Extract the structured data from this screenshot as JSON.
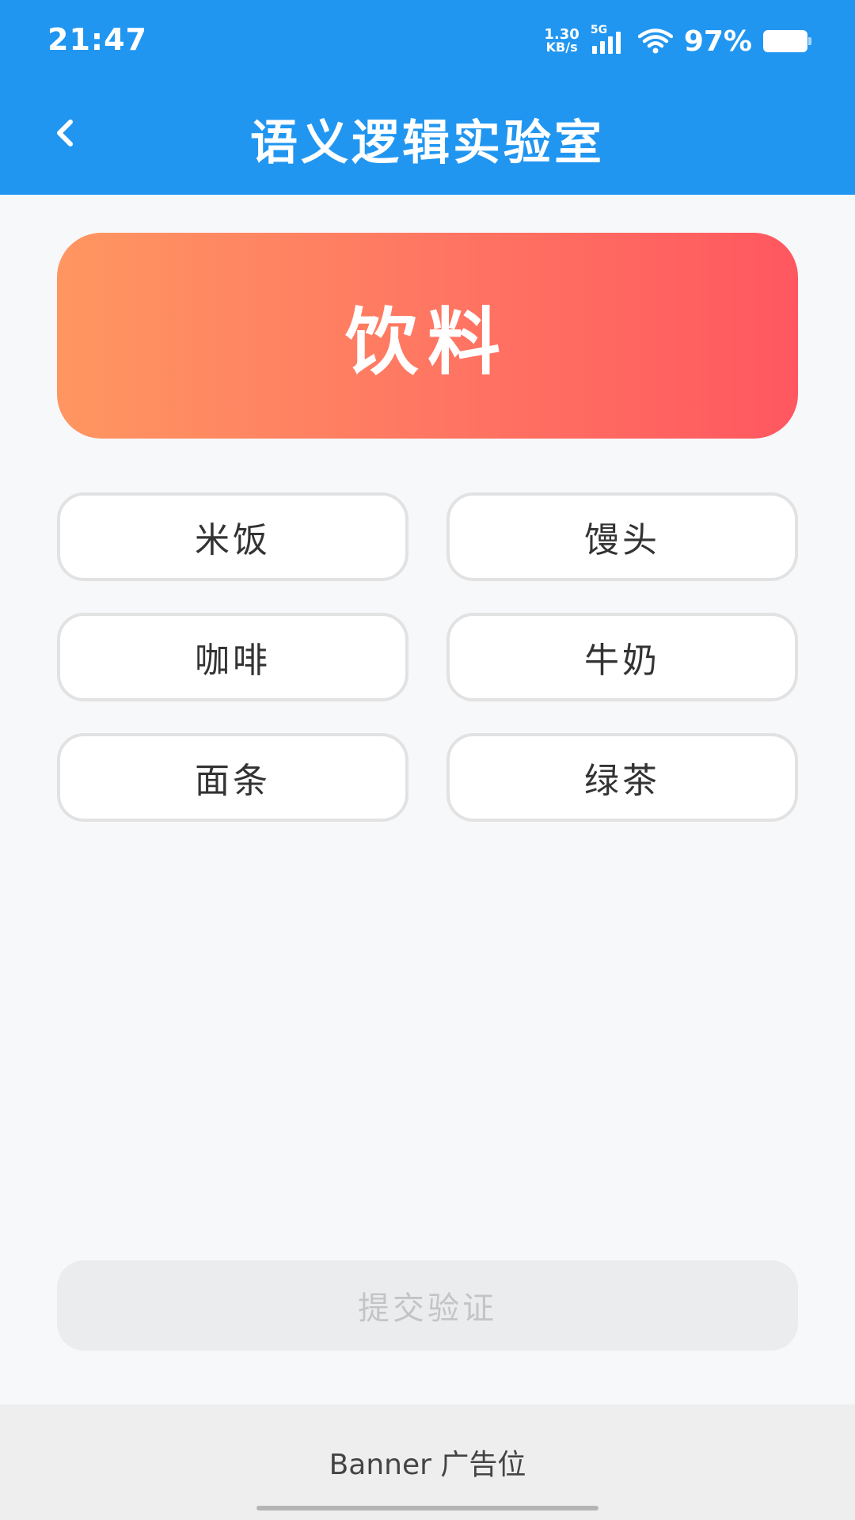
{
  "status_bar": {
    "time": "21:47",
    "net_speed_value": "1.30",
    "net_speed_unit": "KB/s",
    "network_type": "5G",
    "battery_percent": "97%"
  },
  "app_bar": {
    "title": "语义逻辑实验室",
    "back_icon": "chevron-left-icon"
  },
  "category": {
    "label": "饮料"
  },
  "options": [
    {
      "label": "米饭"
    },
    {
      "label": "馒头"
    },
    {
      "label": "咖啡"
    },
    {
      "label": "牛奶"
    },
    {
      "label": "面条"
    },
    {
      "label": "绿茶"
    }
  ],
  "submit": {
    "label": "提交验证"
  },
  "banner": {
    "label": "Banner 广告位"
  },
  "colors": {
    "app_bar": "#2196f0",
    "gradient_start": "#ff9661",
    "gradient_end": "#ff5760",
    "option_border": "#e2e2e2",
    "submit_disabled_bg": "#ebecee",
    "submit_disabled_text": "#c3c4c6"
  }
}
